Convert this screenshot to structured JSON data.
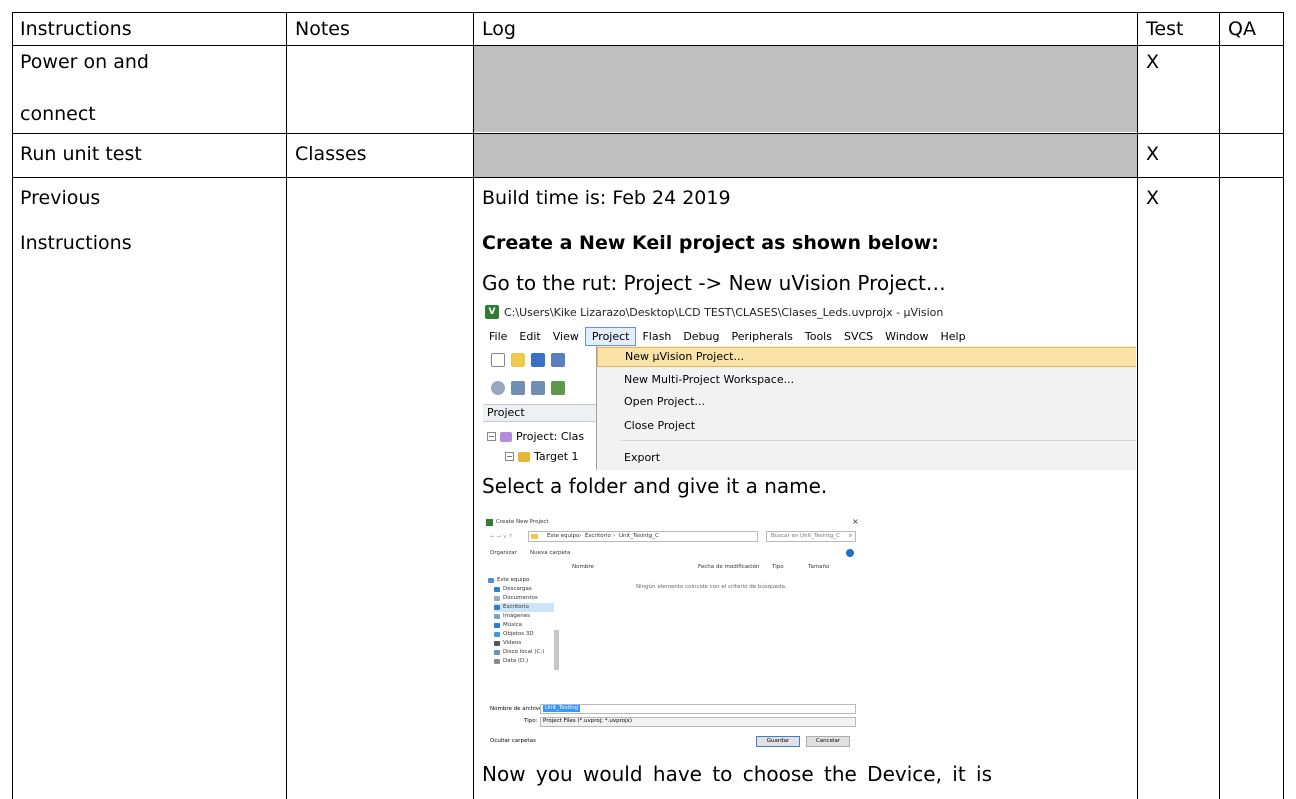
{
  "table": {
    "headers": {
      "instructions": "Instructions",
      "notes": "Notes",
      "log": "Log",
      "test": "Test",
      "qa": "QA"
    },
    "rows": [
      {
        "instructions_line1": "Power on and",
        "instructions_line2": "connect",
        "notes": "",
        "test": "X",
        "qa": ""
      },
      {
        "instructions": "Run unit test",
        "notes": "Classes",
        "test": "X",
        "qa": ""
      },
      {
        "instructions_line1": "Previous",
        "instructions_line2": "Instructions",
        "notes": "",
        "test": "X",
        "qa": ""
      }
    ],
    "log": {
      "build_time": "Build time is: Feb 24 2019",
      "heading": "Create a New Keil project as shown below:",
      "step1": "Go to the rut: Project -> New uVision Project…",
      "step2": "Select a folder and give it a name.",
      "step3": "Now you would have to choose the Device, it is"
    }
  },
  "uvision": {
    "window_title": "C:\\Users\\Kike Lizarazo\\Desktop\\LCD TEST\\CLASES\\Clases_Leds.uvprojx - µVision",
    "logo_text": "V",
    "menus": [
      "File",
      "Edit",
      "View",
      "Project",
      "Flash",
      "Debug",
      "Peripherals",
      "Tools",
      "SVCS",
      "Window",
      "Help"
    ],
    "active_menu": "Project",
    "project_panel_title": "Project",
    "tree_project": "Project: Clas",
    "tree_target": "Target 1",
    "dropdown_items": [
      "New µVision Project...",
      "New Multi-Project Workspace...",
      "Open Project...",
      "Close Project",
      "Export"
    ],
    "highlighted_item": "New µVision Project..."
  },
  "dialog": {
    "title": "Create New Project",
    "path": [
      "Este equipo",
      "Escritorio",
      "Unit_Tesintg_C"
    ],
    "search_placeholder": "Buscar en Unit_Tesintg_C",
    "organize": "Organizar",
    "new_folder": "Nueva carpeta",
    "columns": [
      "Nombre",
      "Fecha de modificación",
      "Tipo",
      "Tamaño"
    ],
    "empty_message": "Ningún elemento coincide con el criterio de búsqueda.",
    "sidebar": [
      "Este equipo",
      "Descargas",
      "Documentos",
      "Escritorio",
      "Imágenes",
      "Música",
      "Objetos 3D",
      "Videos",
      "Disco local (C:)",
      "Data (D:)"
    ],
    "file_name_label": "Nombre de archivo:",
    "file_name_value": "Unit_Testing",
    "type_label": "Tipo:",
    "type_value": "Project Files (*.uvproj; *.uvprojx)",
    "hide_folders": "Ocultar carpetas",
    "save_button": "Guardar",
    "cancel_button": "Cancelar"
  },
  "colors": {
    "grey_cell": "#bfbfbf",
    "menu_highlight": "#fbe3a7",
    "dialog_selection": "#3399ff"
  }
}
